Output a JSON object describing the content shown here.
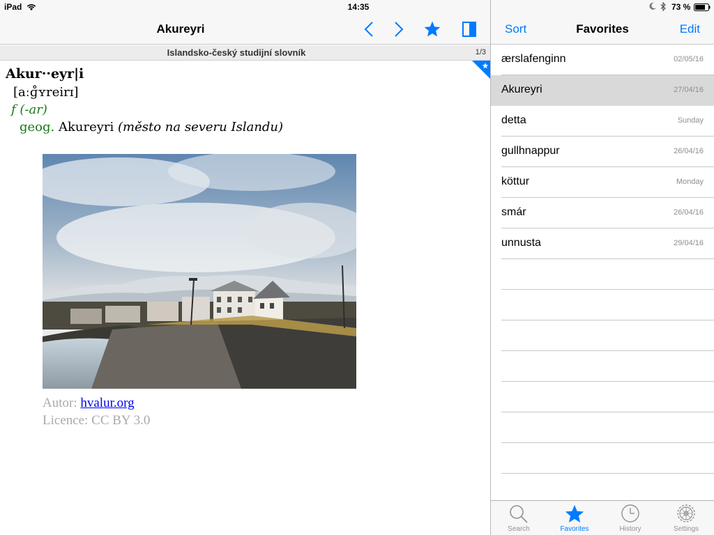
{
  "status_bar": {
    "device": "iPad",
    "time": "14:35",
    "battery": "73 %"
  },
  "nav_left": {
    "title": "Akureyri"
  },
  "dictionary_bar": {
    "name": "Islandsko-český studijní slovník",
    "page": "1/3"
  },
  "entry": {
    "headword": "Akur··eyr|i",
    "pronunciation": "[aːɡ̊ʏreirɪ]",
    "grammar": "f (-ar)",
    "domain": "geog.",
    "translation": "Akureyri",
    "note": "(město na severu Islandu)",
    "credit_author_label": "Autor:",
    "credit_author_link": "hvalur.org",
    "credit_license": "Licence: CC BY 3.0"
  },
  "nav_right": {
    "sort_label": "Sort",
    "title": "Favorites",
    "edit_label": "Edit"
  },
  "favorites": [
    {
      "word": "ærslafenginn",
      "date": "02/05/16"
    },
    {
      "word": "Akureyri",
      "date": "27/04/16"
    },
    {
      "word": "detta",
      "date": "Sunday"
    },
    {
      "word": "gullhnappur",
      "date": "26/04/16"
    },
    {
      "word": "köttur",
      "date": "Monday"
    },
    {
      "word": "smár",
      "date": "26/04/16"
    },
    {
      "word": "unnusta",
      "date": "29/04/16"
    }
  ],
  "tabs": {
    "search": "Search",
    "favorites": "Favorites",
    "history": "History",
    "settings": "Settings"
  },
  "colors": {
    "accent": "#007aff",
    "domain_green": "#1a7a1a",
    "selected_row": "#d9d9d9"
  }
}
